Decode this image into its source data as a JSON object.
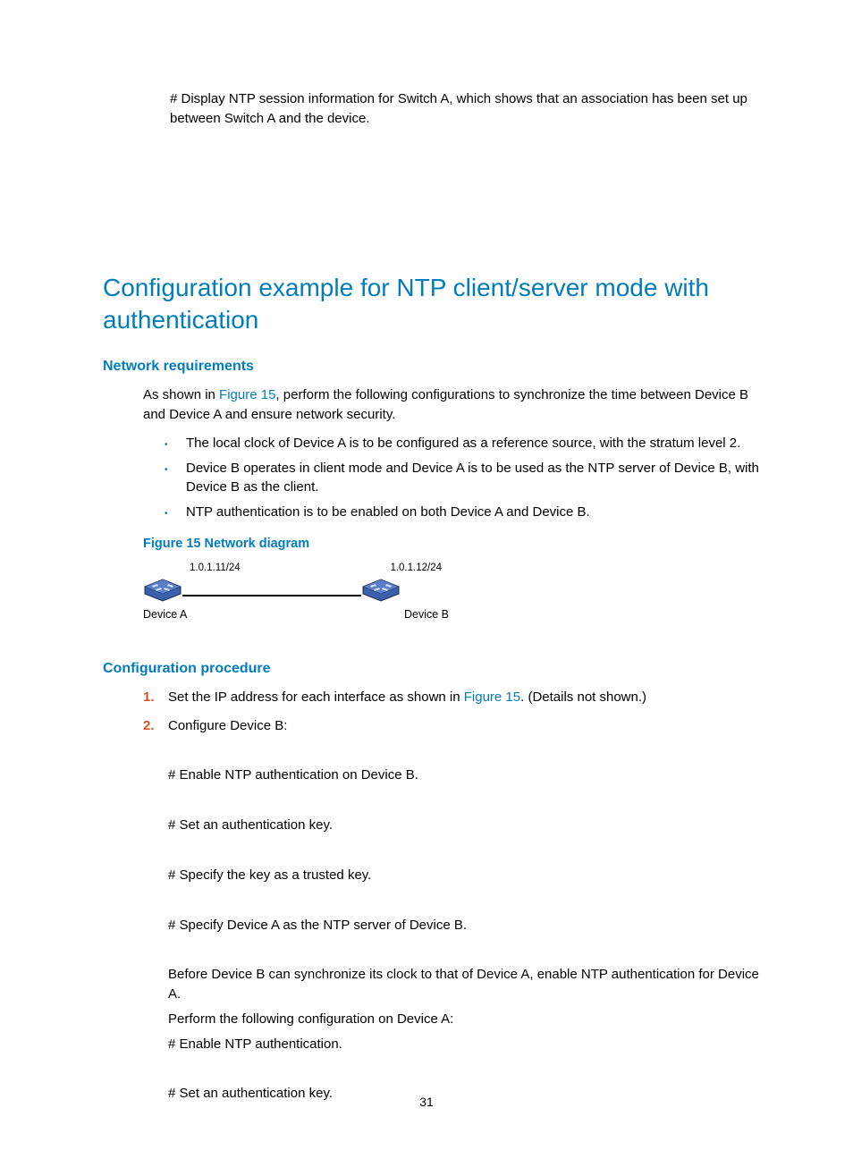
{
  "intro": "# Display NTP session information for Switch A, which shows that an association has been set up between Switch A and the device.",
  "h1": "Configuration example for NTP client/server mode with authentication",
  "netreq": {
    "title": "Network requirements",
    "lead_pre": "As shown in ",
    "lead_link": "Figure 15",
    "lead_post": ", perform the following configurations to synchronize the time between Device B and Device A and ensure network security.",
    "bullets": [
      "The local clock of Device A is to be configured as a reference source, with the stratum level 2.",
      "Device B operates in client mode and Device A is to be used as the NTP server of Device B, with Device B as the client.",
      "NTP authentication is to be enabled on both Device A and Device B."
    ],
    "figcap": "Figure 15 Network diagram",
    "ip_a": "1.0.1.11/24",
    "ip_b": "1.0.1.12/24",
    "dev_a": "Device A",
    "dev_b": "Device B"
  },
  "proc": {
    "title": "Configuration procedure",
    "steps": [
      {
        "num": "1.",
        "text_pre": "Set the IP address for each interface as shown in ",
        "text_link": "Figure 15",
        "text_post": ". (Details not shown.)"
      },
      {
        "num": "2.",
        "header": "Configure Device B:",
        "lines": [
          "# Enable NTP authentication on Device B.",
          "# Set an authentication key.",
          "# Specify the key as a trusted key.",
          "# Specify Device A as the NTP server of Device B."
        ],
        "tail": {
          "p1": "Before Device B can synchronize its clock to that of Device A, enable NTP authentication for Device A.",
          "p2": "Perform the following configuration on Device A:",
          "p3": "# Enable NTP authentication.",
          "p4": "# Set an authentication key."
        }
      }
    ]
  },
  "page_num": "31"
}
